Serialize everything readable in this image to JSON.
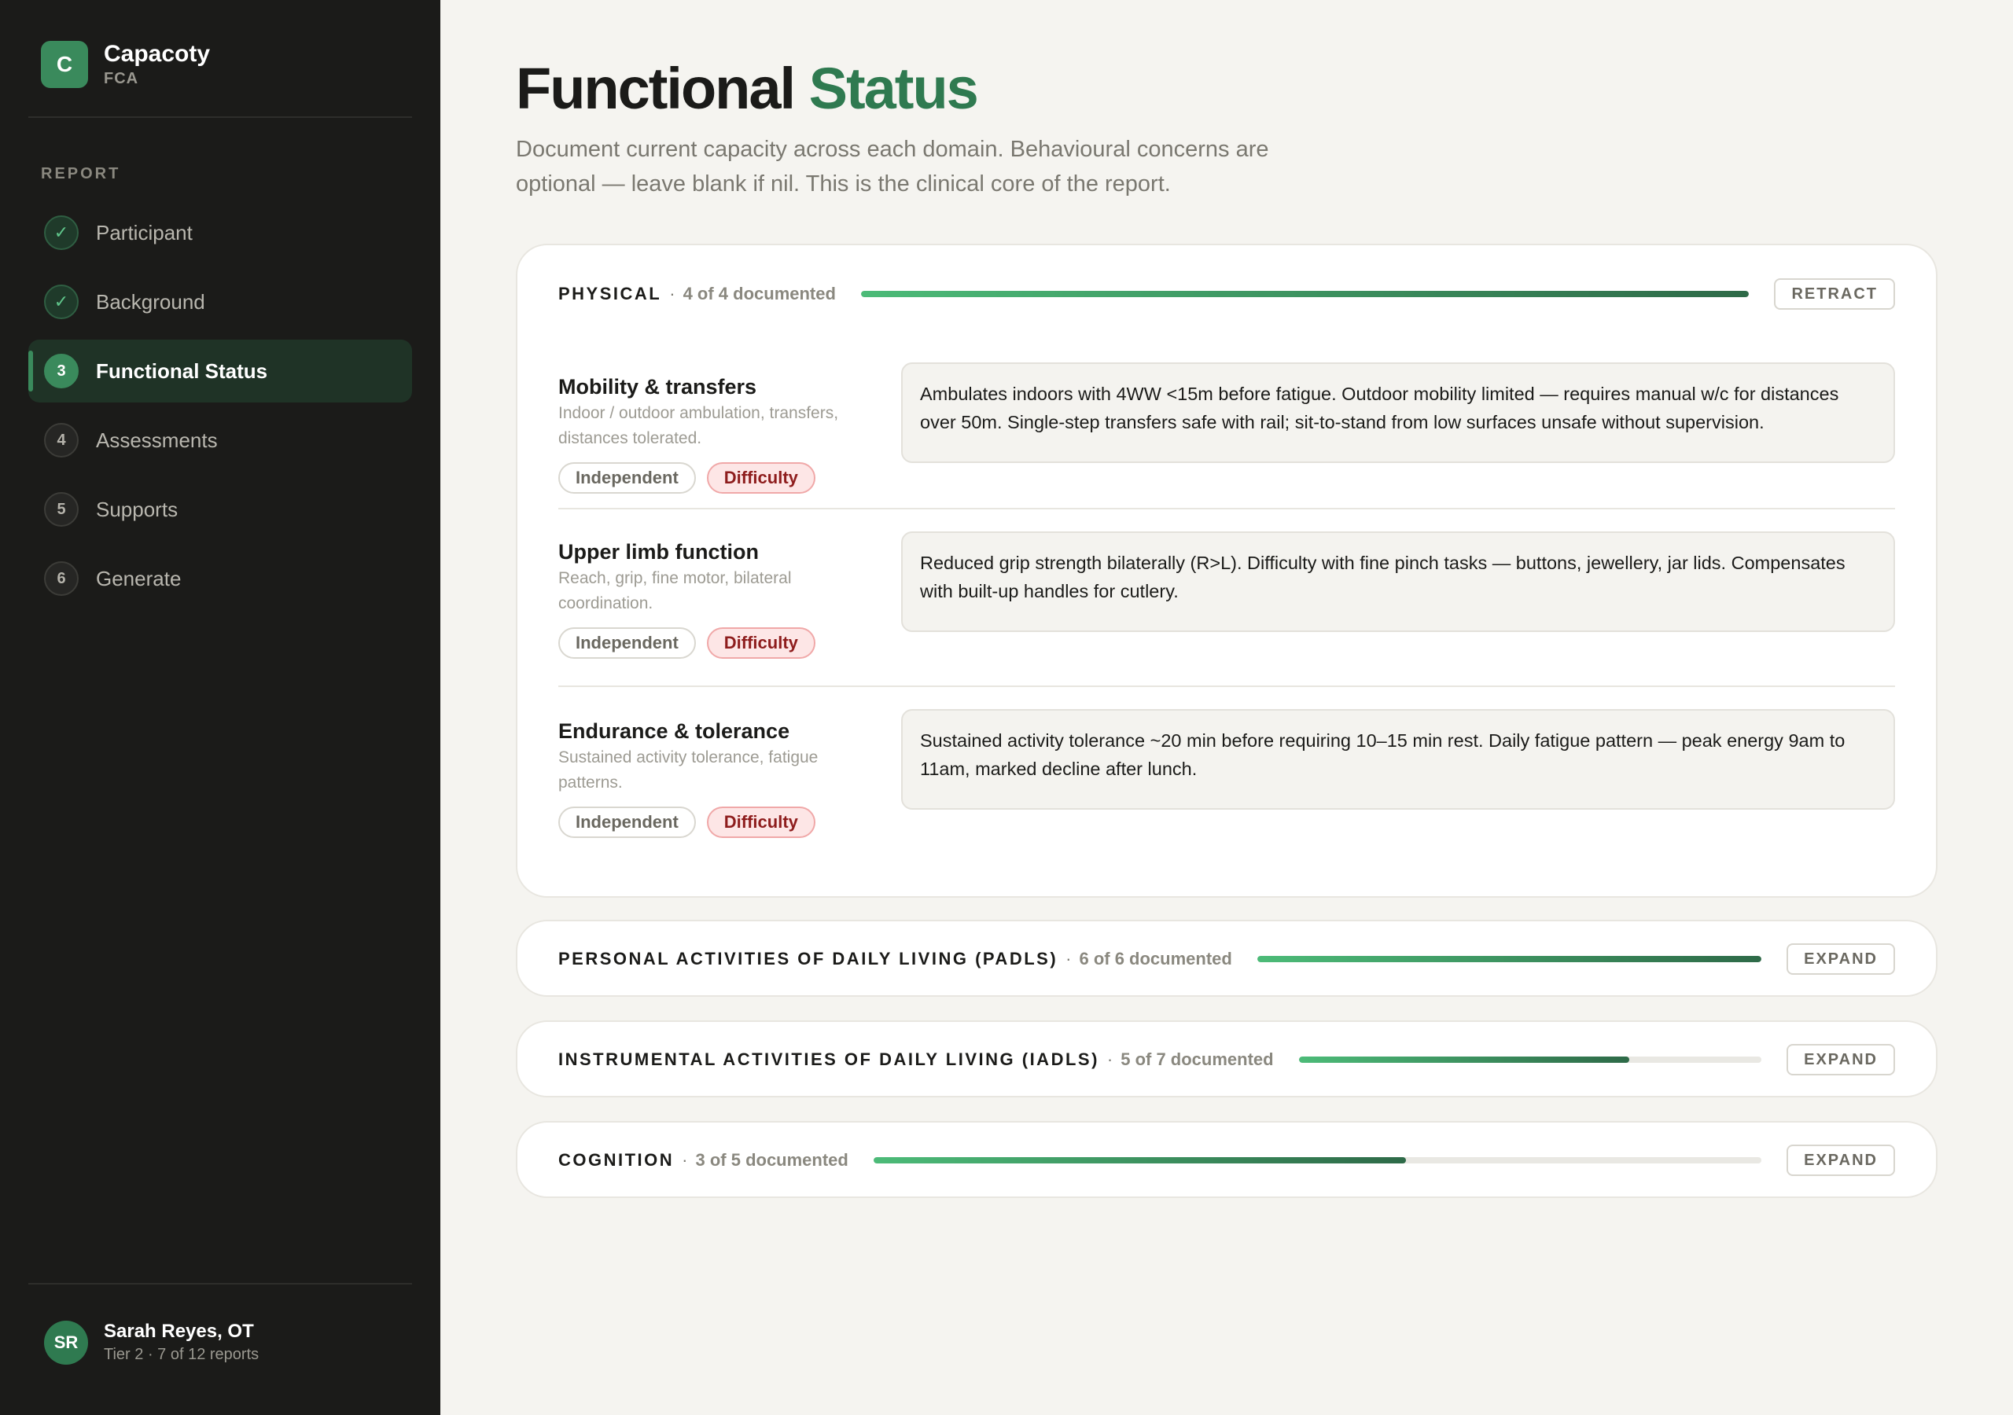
{
  "brand": {
    "initial": "C",
    "name": "Capacoty",
    "subtitle": "FCA"
  },
  "sidebar": {
    "section_label": "REPORT",
    "items": [
      {
        "badge": "✓",
        "label": "Participant",
        "state": "done"
      },
      {
        "badge": "✓",
        "label": "Background",
        "state": "done"
      },
      {
        "badge": "3",
        "label": "Functional Status",
        "state": "current"
      },
      {
        "badge": "4",
        "label": "Assessments",
        "state": "todo"
      },
      {
        "badge": "5",
        "label": "Supports",
        "state": "todo"
      },
      {
        "badge": "6",
        "label": "Generate",
        "state": "todo"
      }
    ],
    "user": {
      "initials": "SR",
      "name": "Sarah Reyes, OT",
      "meta": "Tier 2 · 7 of 12 reports"
    }
  },
  "page": {
    "title_main": "Functional",
    "title_accent": "Status",
    "description": "Document current capacity across each domain. Behavioural concerns are optional — leave blank if nil. This is the clinical core of the report."
  },
  "sections": [
    {
      "title": "PHYSICAL",
      "count": "4 of 4 documented",
      "progress": 1.0,
      "button": "RETRACT",
      "domains": [
        {
          "name": "Mobility & transfers",
          "hint": "Indoor / outdoor ambulation, transfers, distances tolerated.",
          "chip_independent": "Independent",
          "chip_difficulty": "Difficulty",
          "note": "Ambulates indoors with 4WW <15m before fatigue. Outdoor mobility limited — requires manual w/c for distances over 50m. Single-step transfers safe with rail; sit-to-stand from low surfaces unsafe without supervision."
        },
        {
          "name": "Upper limb function",
          "hint": "Reach, grip, fine motor, bilateral coordination.",
          "chip_independent": "Independent",
          "chip_difficulty": "Difficulty",
          "note": "Reduced grip strength bilaterally (R>L). Difficulty with fine pinch tasks — buttons, jewellery, jar lids. Compensates with built-up handles for cutlery."
        },
        {
          "name": "Endurance & tolerance",
          "hint": "Sustained activity tolerance, fatigue patterns.",
          "chip_independent": "Independent",
          "chip_difficulty": "Difficulty",
          "note": "Sustained activity tolerance ~20 min before requiring 10–15 min rest. Daily fatigue pattern — peak energy 9am to 11am, marked decline after lunch."
        }
      ]
    },
    {
      "title": "PERSONAL ACTIVITIES OF DAILY LIVING (PADLS)",
      "count": "6 of 6 documented",
      "progress": 1.0,
      "button": "EXPAND"
    },
    {
      "title": "INSTRUMENTAL ACTIVITIES OF DAILY LIVING (IADLS)",
      "count": "5 of 7 documented",
      "progress": 0.714,
      "button": "EXPAND"
    },
    {
      "title": "COGNITION",
      "count": "3 of 5 documented",
      "progress": 0.6,
      "button": "EXPAND"
    }
  ],
  "colors": {
    "accent": "#2f7a50",
    "sidebar_bg": "#1b1b19",
    "page_bg": "#f5f4f0",
    "difficulty_bg": "#fde6e6",
    "difficulty_text": "#8e1d1d"
  }
}
